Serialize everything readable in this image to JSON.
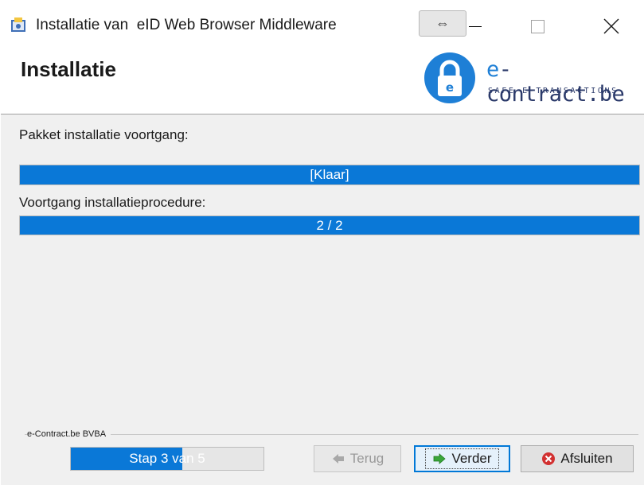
{
  "window": {
    "title": "Installatie van  eID Web Browser Middleware",
    "swap_glyph": "⇔"
  },
  "header": {
    "title": "Installatie",
    "logo": {
      "prefix": "e",
      "main": "-contract.be",
      "tagline": "SAFE E-TRANSACTIONS",
      "lock_letter": "e"
    }
  },
  "body": {
    "package_label": "Pakket installatie voortgang:",
    "package_status": "[Klaar]",
    "package_progress": 1.0,
    "procedure_label": "Voortgang installatieprocedure:",
    "procedure_status": "2 / 2",
    "procedure_progress": 1.0
  },
  "footer": {
    "company": "e-Contract.be BVBA",
    "step_text": "Stap 3 van 5",
    "step_progress": 0.58
  },
  "buttons": {
    "back": "Terug",
    "next": "Verder",
    "exit": "Afsluiten"
  },
  "colors": {
    "accent": "#0a78d7",
    "logo_blue": "#1e7fd6",
    "logo_dark": "#2b3a6a",
    "next_icon": "#3aa63a",
    "exit_icon": "#d23030"
  }
}
